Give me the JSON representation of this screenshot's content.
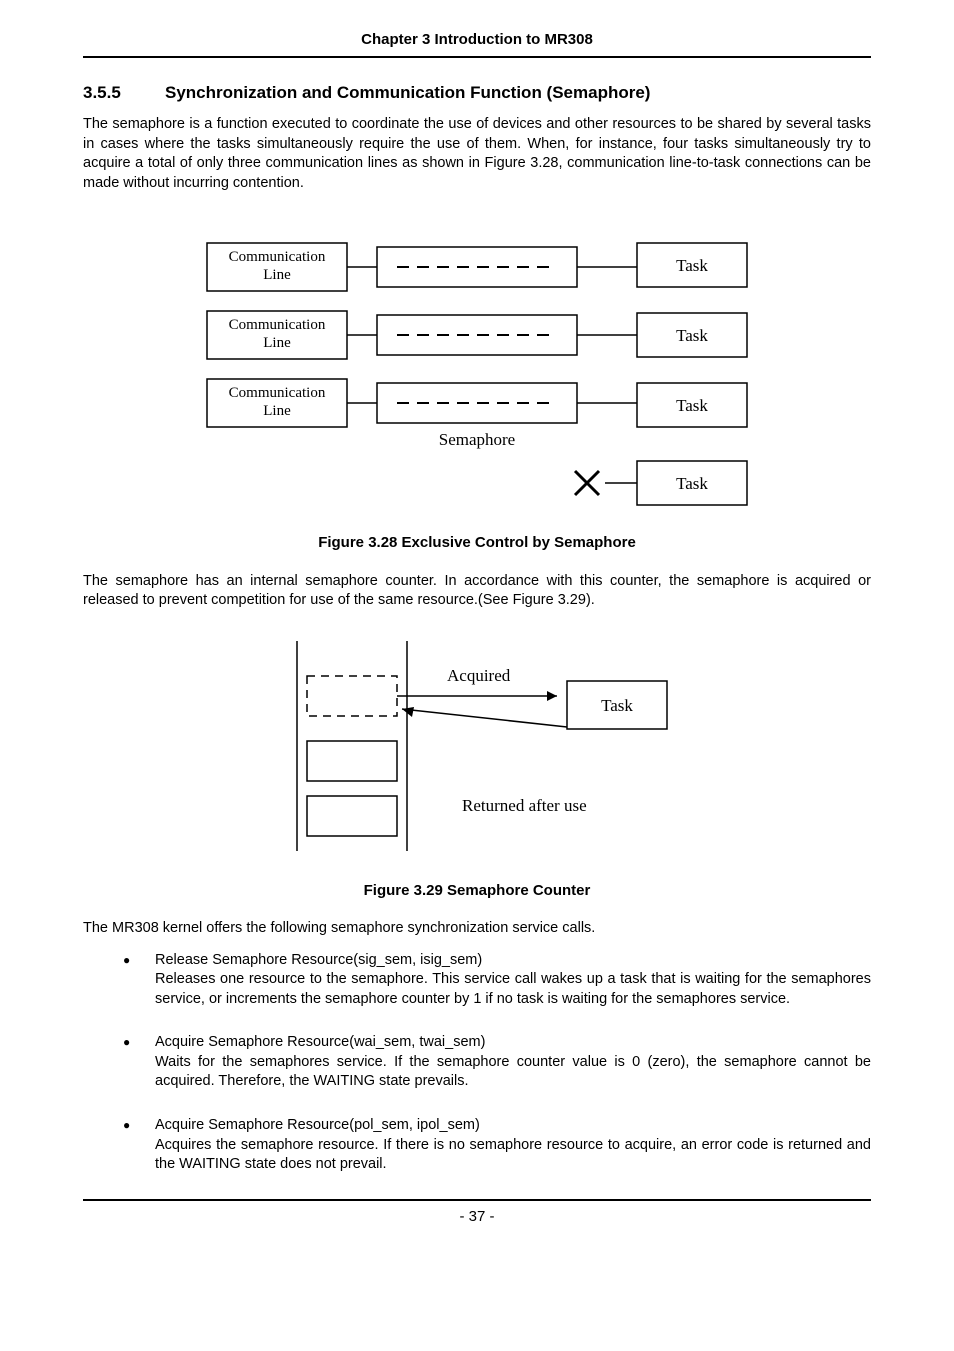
{
  "header": {
    "chapter": "Chapter 3 Introduction to MR308"
  },
  "section": {
    "num": "3.5.5",
    "title": "Synchronization and Communication Function (Semaphore)"
  },
  "para1": "The semaphore is a function executed to coordinate the use of devices and other resources to be shared by several tasks in cases where the tasks simultaneously require the use of them. When, for instance, four tasks simultaneously try to acquire a total of only three communication lines as shown in Figure 3.28, communication line-to-task connections can be made without incurring contention.",
  "fig28": {
    "comm_line": "Communication\nLine",
    "task": "Task",
    "semaphore": "Semaphore",
    "caption": "Figure 3.28 Exclusive Control by Semaphore"
  },
  "para2": "The semaphore has an internal semaphore counter. In accordance with this counter, the semaphore is acquired or released to prevent competition for use of the same resource.(See Figure 3.29).",
  "fig29": {
    "acquired": "Acquired",
    "task": "Task",
    "returned": "Returned after use",
    "caption": "Figure 3.29 Semaphore Counter"
  },
  "para3": "The MR308 kernel offers the following semaphore synchronization service calls.",
  "bullets": [
    {
      "head": "Release Semaphore Resource(sig_sem, isig_sem)",
      "body": "Releases one resource to the semaphore. This service call wakes up a task that is waiting for the semaphores service, or increments the semaphore counter by 1 if no task is waiting for the semaphores service."
    },
    {
      "head": "Acquire Semaphore Resource(wai_sem, twai_sem)",
      "body": "Waits for the semaphores service. If the semaphore counter value is 0 (zero), the semaphore cannot be acquired. Therefore, the WAITING state prevails."
    },
    {
      "head": "Acquire Semaphore Resource(pol_sem, ipol_sem)",
      "body": "Acquires the semaphore resource. If there is no semaphore resource to acquire, an error code is returned and the WAITING state does not prevail."
    }
  ],
  "footer": {
    "page": "- 37 -"
  }
}
